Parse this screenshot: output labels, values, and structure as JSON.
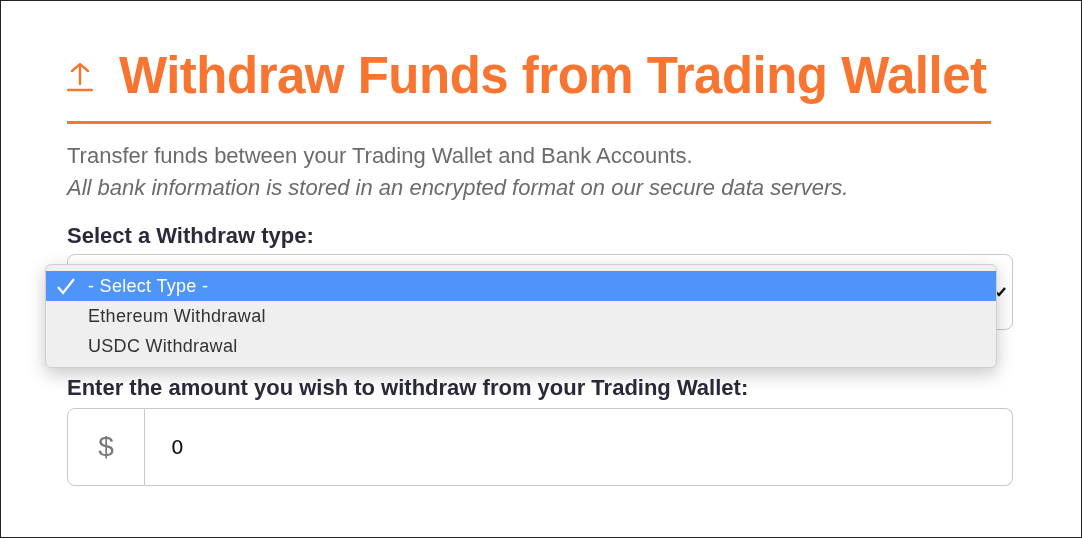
{
  "title": "Withdraw Funds from Trading Wallet",
  "description": "Transfer funds between your Trading Wallet and Bank Accounts.",
  "note": "All bank information is stored in an encrypted format on our secure data servers.",
  "withdraw_type": {
    "label": "Select a Withdraw type:",
    "expanded": true,
    "options": [
      {
        "label": "- Select Type -",
        "selected": true
      },
      {
        "label": "Ethereum Withdrawal",
        "selected": false
      },
      {
        "label": "USDC Withdrawal",
        "selected": false
      }
    ]
  },
  "amount": {
    "label": "Enter the amount you wish to withdraw from your Trading Wallet:",
    "prefix": "$",
    "value": "0"
  }
}
